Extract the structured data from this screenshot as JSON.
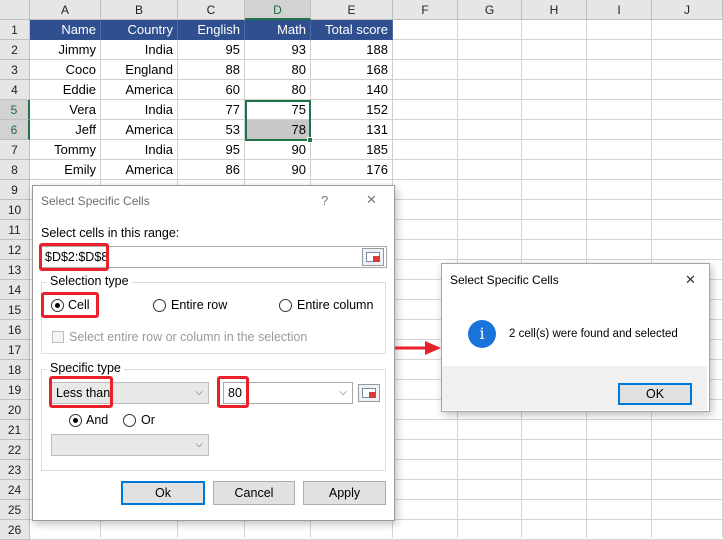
{
  "sheet": {
    "columns": [
      "A",
      "B",
      "C",
      "D",
      "E",
      "F",
      "G",
      "H",
      "I",
      "J"
    ],
    "rows": [
      "1",
      "2",
      "3",
      "4",
      "5",
      "6",
      "7",
      "8",
      "9",
      "10",
      "11",
      "12",
      "13",
      "14",
      "15",
      "16",
      "17",
      "18",
      "19",
      "20",
      "21",
      "22",
      "23",
      "24",
      "25",
      "26"
    ],
    "headers": [
      "Name",
      "Country",
      "English",
      "Math",
      "Total score"
    ],
    "data": [
      [
        "Jimmy",
        "India",
        "95",
        "93",
        "188"
      ],
      [
        "Coco",
        "England",
        "88",
        "80",
        "168"
      ],
      [
        "Eddie",
        "America",
        "60",
        "80",
        "140"
      ],
      [
        "Vera",
        "India",
        "77",
        "75",
        "152"
      ],
      [
        "Jeff",
        "America",
        "53",
        "78",
        "131"
      ],
      [
        "Tommy",
        "India",
        "95",
        "90",
        "185"
      ],
      [
        "Emily",
        "America",
        "86",
        "90",
        "176"
      ]
    ],
    "header_color": "#2f4f8f",
    "selection_color": "#217346"
  },
  "dialog_main": {
    "title": "Select Specific Cells",
    "help": "?",
    "close": "✕",
    "range_label": "Select cells in this range:",
    "range_value": "$D$2:$D$8",
    "selection_type_label": "Selection type",
    "opt_cell": "Cell",
    "opt_entire_row": "Entire row",
    "opt_entire_column": "Entire column",
    "checkbox_label": "Select entire row or column in the selection",
    "specific_type_label": "Specific type",
    "condition1": "Less than",
    "value1": "80",
    "opt_and": "And",
    "opt_or": "Or",
    "condition2": "",
    "ok": "Ok",
    "cancel": "Cancel",
    "apply": "Apply"
  },
  "dialog_result": {
    "title": "Select Specific Cells",
    "close": "✕",
    "message": "2 cell(s) were found and selected",
    "info_icon": "i",
    "ok": "OK"
  },
  "colors": {
    "highlight_red": "#e8212a",
    "info_blue": "#1a73d9",
    "focus_blue": "#0078d7"
  }
}
